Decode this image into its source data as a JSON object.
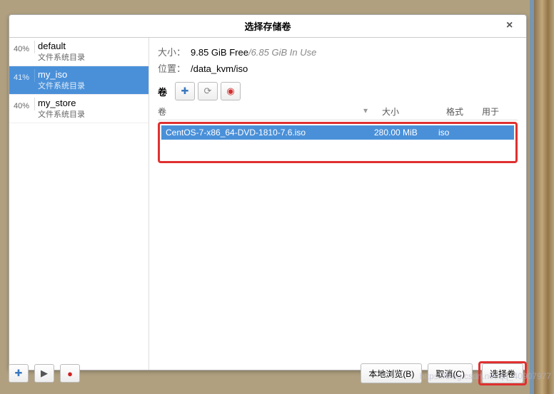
{
  "dialog": {
    "title": "选择存储卷",
    "close_glyph": "×"
  },
  "sidebar": {
    "pools": [
      {
        "percent": "40%",
        "name": "default",
        "subtitle": "文件系统目录",
        "selected": false
      },
      {
        "percent": "41%",
        "name": "my_iso",
        "subtitle": "文件系统目录",
        "selected": true
      },
      {
        "percent": "40%",
        "name": "my_store",
        "subtitle": "文件系统目录",
        "selected": false
      }
    ]
  },
  "details": {
    "size_label": "大小：",
    "free": "9.85 GiB Free",
    "sep": " / ",
    "inuse": "6.85 GiB In Use",
    "location_label": "位置：",
    "location": "/data_kvm/iso",
    "volumes_label": "卷",
    "columns": {
      "name": "卷",
      "size": "大小",
      "format": "格式",
      "used": "用于"
    },
    "selected_volume": {
      "name": "CentOS-7-x86_64-DVD-1810-7.6.iso",
      "size": "280.00 MiB",
      "format": "iso",
      "used": ""
    }
  },
  "buttons": {
    "add": "✚",
    "refresh": "⟳",
    "delete": "◉",
    "browse_local": "本地浏览(B)",
    "cancel": "取消(C)",
    "choose": "选择卷"
  },
  "toolbar_bottom": {
    "play": "▶",
    "record": "●"
  },
  "watermark": "https://blog.csdn.net/qq_40907977"
}
